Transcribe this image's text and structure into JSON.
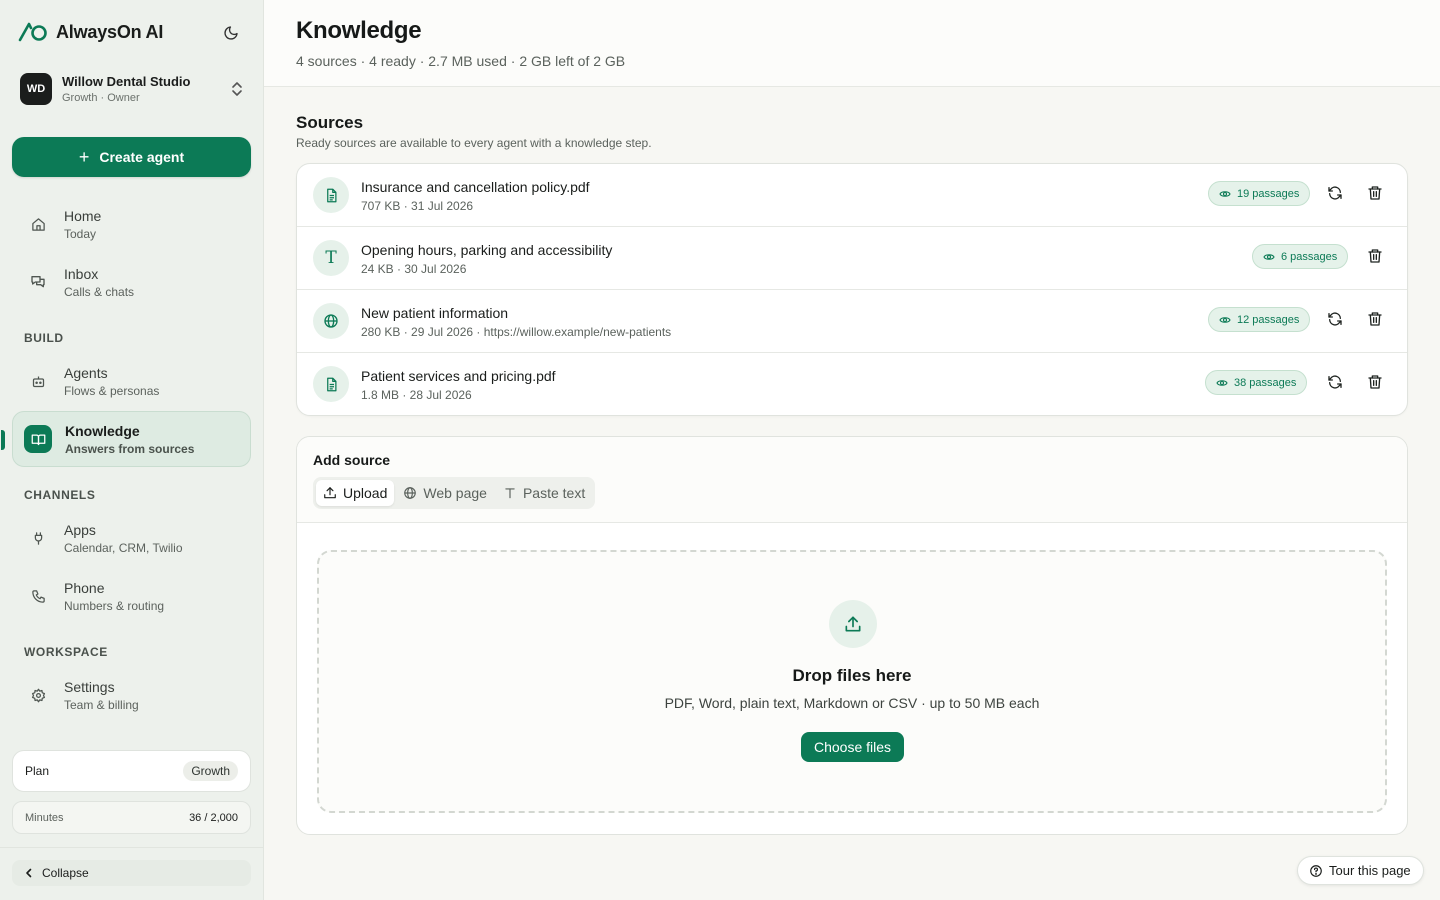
{
  "app": {
    "name": "AlwaysOn AI"
  },
  "workspace": {
    "initials": "WD",
    "name": "Willow Dental Studio",
    "subtitle": "Growth · Owner"
  },
  "sidebar": {
    "create_label": "Create agent",
    "nav": [
      {
        "label": "Home",
        "sub": "Today",
        "icon": "home-icon"
      },
      {
        "label": "Inbox",
        "sub": "Calls & chats",
        "icon": "chat-icon"
      },
      {
        "label": "Agents",
        "sub": "Flows & personas",
        "icon": "bot-icon"
      },
      {
        "label": "Knowledge",
        "sub": "Answers from sources",
        "icon": "book-icon",
        "active": true
      },
      {
        "label": "Apps",
        "sub": "Calendar, CRM, Twilio",
        "icon": "plug-icon"
      },
      {
        "label": "Phone",
        "sub": "Numbers & routing",
        "icon": "phone-icon"
      },
      {
        "label": "Settings",
        "sub": "Team & billing",
        "icon": "gear-icon"
      }
    ],
    "sections": {
      "build": "BUILD",
      "channels": "CHANNELS",
      "workspace": "WORKSPACE"
    },
    "plan": {
      "label": "Plan",
      "value": "Growth"
    },
    "minutes": {
      "label": "Minutes",
      "value": "36 / 2,000"
    },
    "collapse_label": "Collapse"
  },
  "header": {
    "title": "Knowledge",
    "subtitle": "4 sources · 4 ready · 2.7 MB used · 2 GB left of 2 GB"
  },
  "sources": {
    "title": "Sources",
    "subtitle": "Ready sources are available to every agent with a knowledge step.",
    "items": [
      {
        "name": "Insurance and cancellation policy.pdf",
        "meta": "707 KB · 31 Jul 2026",
        "passages": "19 passages",
        "icon": "document-icon",
        "refreshable": true
      },
      {
        "name": "Opening hours, parking and accessibility",
        "meta": "24 KB · 30 Jul 2026",
        "passages": "6 passages",
        "icon": "text-icon",
        "icon_glyph": "T",
        "refreshable": false
      },
      {
        "name": "New patient information",
        "meta": "280 KB · 29 Jul 2026 · https://willow.example/new-patients",
        "passages": "12 passages",
        "icon": "globe-icon",
        "refreshable": true
      },
      {
        "name": "Patient services and pricing.pdf",
        "meta": "1.8 MB · 28 Jul 2026",
        "passages": "38 passages",
        "icon": "document-icon",
        "refreshable": true
      }
    ]
  },
  "add_source": {
    "title": "Add source",
    "tabs": [
      {
        "label": "Upload",
        "icon": "upload-icon",
        "active": true
      },
      {
        "label": "Web page",
        "icon": "globe-icon",
        "active": false
      },
      {
        "label": "Paste text",
        "icon": "text-icon",
        "active": false
      }
    ],
    "dropzone": {
      "title": "Drop files here",
      "subtitle": "PDF, Word, plain text, Markdown or CSV · up to 50 MB each",
      "button": "Choose files"
    }
  },
  "tour": {
    "label": "Tour this page"
  },
  "colors": {
    "accent": "#0c7a56",
    "accent_soft": "#e6f1ea",
    "sidebar_bg": "#edf1ec"
  }
}
